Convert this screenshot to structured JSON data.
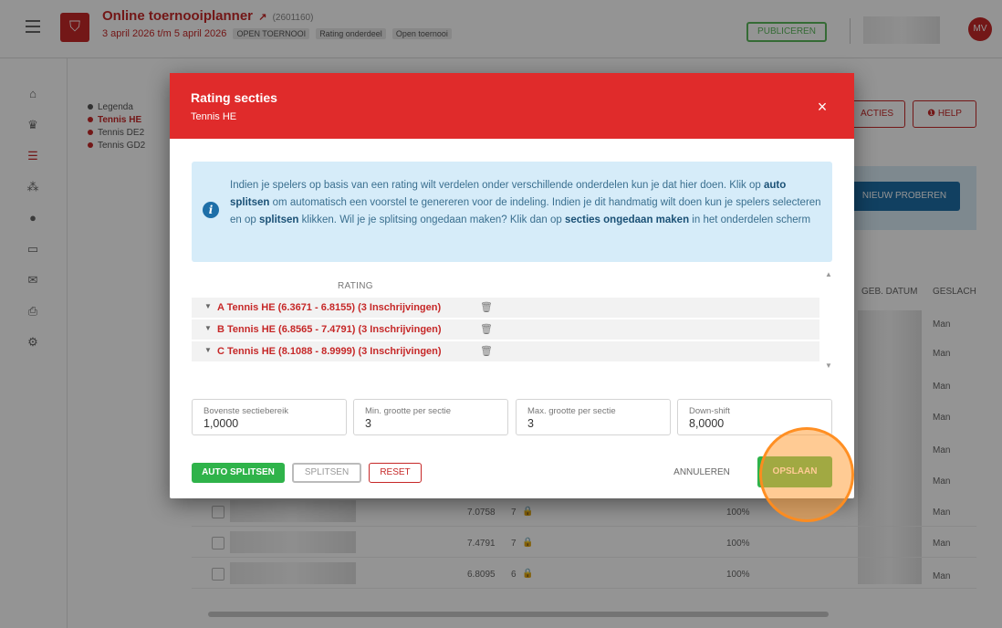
{
  "app": {
    "title": "Online toernooiplanner",
    "external_icon": "↗",
    "code": "(2601160)",
    "subtitle": "3 april 2026 t/m 5 april 2026",
    "chips": [
      "OPEN TOERNOOI",
      "Rating onderdeel",
      "Open toernooi"
    ],
    "publish_label": "PUBLICEREN",
    "avatar_initials": "MV"
  },
  "sidebar": {
    "icons": [
      "home-icon",
      "trophy-icon",
      "list-icon",
      "tree-icon",
      "ball-icon",
      "monitor-icon",
      "mail-icon",
      "print-icon",
      "gear-icon"
    ]
  },
  "legend": {
    "title": "Legenda",
    "items": [
      "Tennis HE",
      "Tennis DE2",
      "Tennis GD2"
    ]
  },
  "background": {
    "actions_label": "ACTIES",
    "help_label": "HELP",
    "retry_label": "NIEUW PROBEREN",
    "col_birth": "GEB. DATUM",
    "col_gender": "GESLACH",
    "gender_values": [
      "Man",
      "Man",
      "Man",
      "Man",
      "Man",
      "Man",
      "Man",
      "Man",
      "Man"
    ],
    "rows": [
      {
        "rating": "7.0758",
        "level": "7",
        "pct": "100%"
      },
      {
        "rating": "7.4791",
        "level": "7",
        "pct": "100%"
      },
      {
        "rating": "6.8095",
        "level": "6",
        "pct": "100%"
      }
    ]
  },
  "modal": {
    "title": "Rating secties",
    "subtitle": "Tennis HE",
    "close_label": "×",
    "info": {
      "t1": "Indien je spelers op basis van een rating wilt verdelen onder verschillende onderdelen kun je dat hier doen. Klik op ",
      "b1": "auto splitsen",
      "t2": " om automatisch een voorstel te genereren voor de indeling. Indien je dit handmatig wilt doen kun je spelers selecteren en op ",
      "b2": "splitsen",
      "t3": " klikken. Wil je je splitsing ongedaan maken? Klik dan op ",
      "b3": "secties ongedaan maken",
      "t4": " in het onderdelen scherm"
    },
    "rating_header": "RATING",
    "sections": [
      {
        "label": "A Tennis HE (6.3671 - 6.8155) (3 Inschrijvingen)"
      },
      {
        "label": "B Tennis HE (6.8565 - 7.4791) (3 Inschrijvingen)"
      },
      {
        "label": "C Tennis HE (8.1088 - 8.9999) (3 Inschrijvingen)"
      }
    ],
    "fields": {
      "upper": {
        "label": "Bovenste sectiebereik",
        "value": "1,0000"
      },
      "min": {
        "label": "Min. grootte per sectie",
        "value": "3"
      },
      "max": {
        "label": "Max. grootte per sectie",
        "value": "3"
      },
      "downshift": {
        "label": "Down-shift",
        "value": "8,0000"
      }
    },
    "buttons": {
      "auto": "AUTO SPLITSEN",
      "split": "SPLITSEN",
      "reset": "RESET",
      "cancel": "ANNULEREN",
      "save": "OPSLAAN"
    }
  }
}
